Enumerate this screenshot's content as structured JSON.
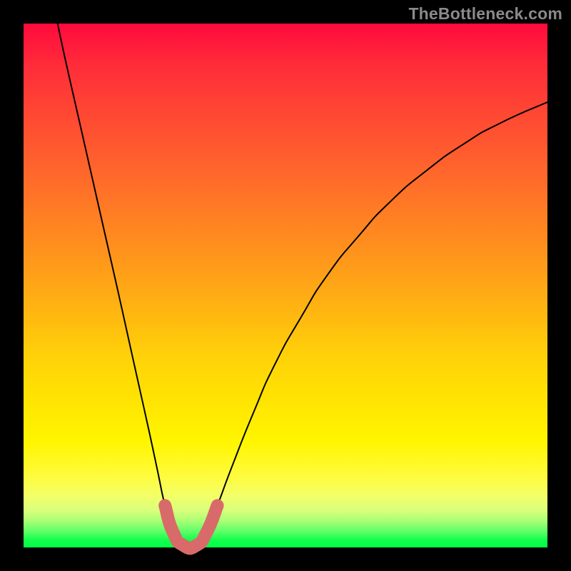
{
  "watermark": "TheBottleneck.com",
  "chart_data": {
    "type": "line",
    "title": "",
    "xlabel": "",
    "ylabel": "",
    "xlim": [
      0,
      100
    ],
    "ylim": [
      0,
      100
    ],
    "grid": false,
    "legend": false,
    "series": [
      {
        "name": "bottleneck-curve",
        "points": [
          {
            "x": 6.5,
            "y": 100.0
          },
          {
            "x": 8.0,
            "y": 93.0
          },
          {
            "x": 10.5,
            "y": 82.0
          },
          {
            "x": 13.0,
            "y": 71.0
          },
          {
            "x": 15.5,
            "y": 60.0
          },
          {
            "x": 18.0,
            "y": 49.0
          },
          {
            "x": 20.0,
            "y": 40.0
          },
          {
            "x": 22.0,
            "y": 31.0
          },
          {
            "x": 24.0,
            "y": 22.0
          },
          {
            "x": 25.5,
            "y": 15.0
          },
          {
            "x": 27.0,
            "y": 8.0
          },
          {
            "x": 28.5,
            "y": 3.0
          },
          {
            "x": 30.5,
            "y": 0.4
          },
          {
            "x": 33.0,
            "y": 0.4
          },
          {
            "x": 35.0,
            "y": 3.0
          },
          {
            "x": 37.0,
            "y": 8.0
          },
          {
            "x": 40.0,
            "y": 16.0
          },
          {
            "x": 44.0,
            "y": 26.0
          },
          {
            "x": 48.0,
            "y": 35.0
          },
          {
            "x": 53.0,
            "y": 44.0
          },
          {
            "x": 58.0,
            "y": 52.0
          },
          {
            "x": 64.0,
            "y": 59.5
          },
          {
            "x": 70.0,
            "y": 66.0
          },
          {
            "x": 77.0,
            "y": 72.0
          },
          {
            "x": 84.0,
            "y": 77.0
          },
          {
            "x": 91.0,
            "y": 81.0
          },
          {
            "x": 100.0,
            "y": 85.0
          }
        ]
      },
      {
        "name": "highlight-band",
        "color": "#d96a6a",
        "points": [
          {
            "x": 27.0,
            "y": 8.0
          },
          {
            "x": 28.5,
            "y": 3.0
          },
          {
            "x": 30.5,
            "y": 0.4
          },
          {
            "x": 33.0,
            "y": 0.4
          },
          {
            "x": 35.0,
            "y": 3.0
          },
          {
            "x": 37.0,
            "y": 8.0
          }
        ]
      }
    ]
  }
}
